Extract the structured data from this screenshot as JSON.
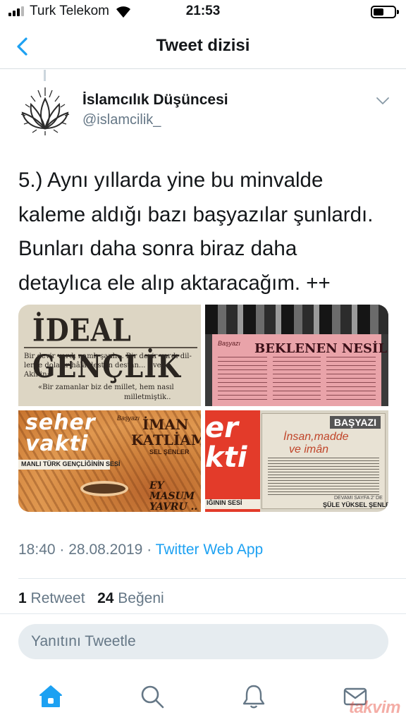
{
  "status_bar": {
    "carrier": "Turk Telekom",
    "time": "21:53"
  },
  "nav": {
    "title": "Tweet dizisi"
  },
  "tweet": {
    "author_name": "İslamcılık Düşüncesi",
    "author_handle": "@islamcilik_",
    "text": "5.) Aynı yıllarda yine bu minvalde\nkaleme aldığı bazı başyazılar şunlardı.\nBunları daha sonra biraz daha\ndetaylıca ele alıp aktaracağım. ++",
    "time": "18:40",
    "date": "28.08.2019",
    "separator": "·",
    "source": "Twitter Web App",
    "retweet_count": "1",
    "retweet_label": "Retweet",
    "like_count": "24",
    "like_label": "Beğeni"
  },
  "media": {
    "image1": {
      "title": "İDEAL GENÇLİK",
      "line1": "Bir devir vardı namlı şanlı... Bir devir vardı dil-",
      "line2": "lerde dolaşır hâlâ destan destan...       Evet",
      "line3": "Akif'in:",
      "line4": "«Bir zamanlar biz de millet, hem nasıl",
      "line5": "milletmiştik.."
    },
    "image2": {
      "prefix": "Başyazı",
      "title": "BEKLENEN NESİL"
    },
    "image3": {
      "logo_line1": "seher",
      "logo_line2": "vakti",
      "subtitle": "MANLI TÜRK GENÇLİĞİNİN SESİ",
      "prefix": "Başyazı",
      "title_line1": "İMAN",
      "title_line2": "KATLİAMI",
      "author": "SEL ŞENLER",
      "caption_line1": "EY",
      "caption_line2": "MASUM",
      "caption_line3": "YAVRU .."
    },
    "image4": {
      "logo_line1": "er",
      "logo_line2": "kti",
      "subtitle": "IĞININ SESİ",
      "header": "BAŞYAZI",
      "title_line1": "İnsan,madde",
      "title_line2": "ve imân",
      "continued": "DEVAMI SAYFA 2' DE",
      "author": "ŞÜLE YÜKSEL ŞENLER"
    }
  },
  "reply": {
    "placeholder": "Yanıtını Tweetle"
  },
  "watermark": "takvim",
  "colors": {
    "accent": "#1da1f2",
    "text": "#14171a",
    "secondary": "#657786",
    "reply_bg": "#e6ecf0"
  },
  "icons": {
    "back": "chevron-left-icon",
    "caret": "chevron-down-icon",
    "home": "home-icon",
    "search": "search-icon",
    "notifications": "bell-icon",
    "messages": "mail-icon"
  }
}
